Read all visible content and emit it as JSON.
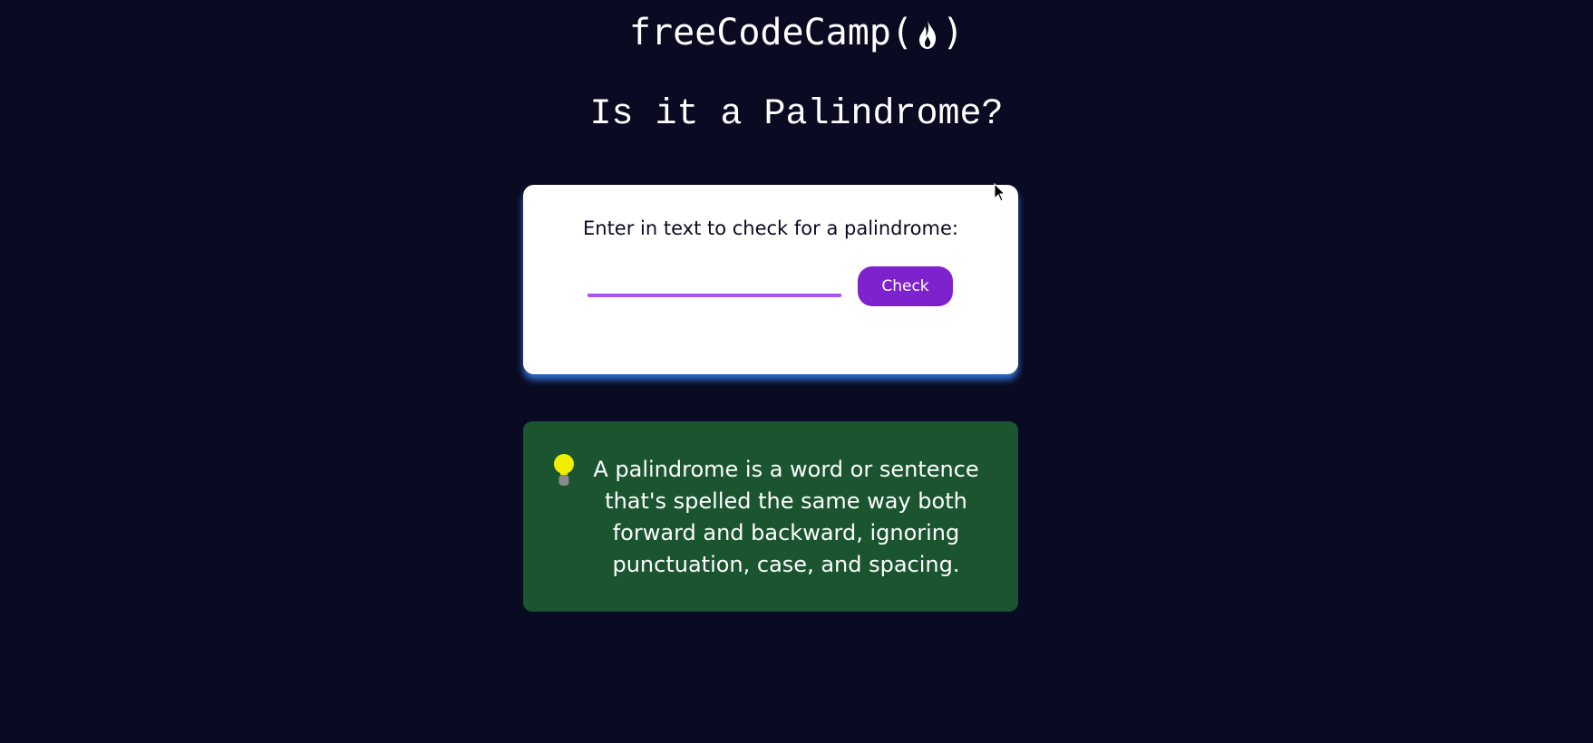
{
  "header": {
    "logo_text_prefix": "freeCodeCamp(",
    "logo_text_suffix": ")",
    "logo_icon": "flame-icon"
  },
  "page": {
    "title": "Is it a Palindrome?"
  },
  "checker": {
    "label": "Enter in text to check for a palindrome:",
    "input_value": "",
    "input_placeholder": "",
    "button_label": "Check"
  },
  "info": {
    "icon": "lightbulb-icon",
    "text": "A palindrome is a word or sentence that's spelled the same way both forward and backward, ignoring punctuation, case, and spacing."
  },
  "colors": {
    "background": "#0a0a23",
    "card": "#ffffff",
    "accent_purple": "#7e22ce",
    "input_underline": "#a855f7",
    "info_green": "#1b5530",
    "bulb_yellow": "#f1ee00"
  }
}
